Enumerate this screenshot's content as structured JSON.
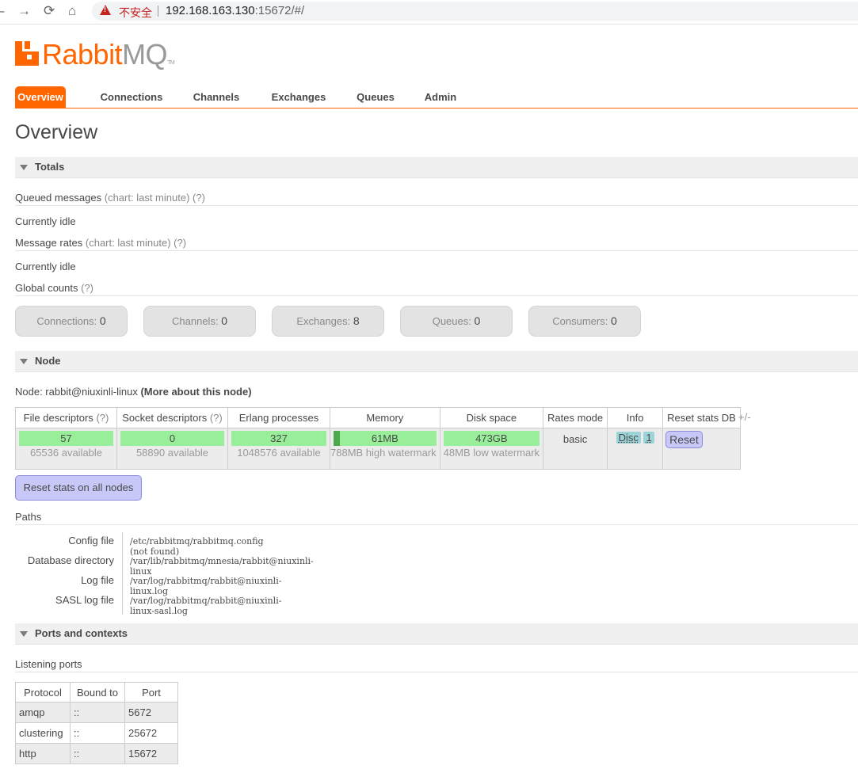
{
  "browser": {
    "back_icon": "back-arrow",
    "forward_icon": "forward-arrow",
    "reload_icon": "reload",
    "home_icon": "home",
    "security_text": "不安全",
    "url_host": "192.168.163.130",
    "url_rest": ":15672/#/"
  },
  "logo": {
    "rabbit": "Rabbit",
    "mq": "MQ",
    "tm": "TM"
  },
  "tabs": [
    "Overview",
    "Connections",
    "Channels",
    "Exchanges",
    "Queues",
    "Admin"
  ],
  "page_title": "Overview",
  "totals": {
    "title": "Totals",
    "queued_label": "Queued messages",
    "queued_hint": "(chart: last minute) (?)",
    "queued_state": "Currently idle",
    "rates_label": "Message rates",
    "rates_hint": "(chart: last minute) (?)",
    "rates_state": "Currently idle",
    "global_label": "Global counts",
    "global_hint": "(?)",
    "counts": [
      {
        "label": "Connections:",
        "value": "0"
      },
      {
        "label": "Channels:",
        "value": "0"
      },
      {
        "label": "Exchanges:",
        "value": "8"
      },
      {
        "label": "Queues:",
        "value": "0"
      },
      {
        "label": "Consumers:",
        "value": "0"
      }
    ]
  },
  "node": {
    "title": "Node",
    "node_label": "Node: rabbit@niuxinli-linux",
    "more_link": "(More about this node)",
    "headers": {
      "fd": "File descriptors",
      "fd_hint": "(?)",
      "sd": "Socket descriptors",
      "sd_hint": "(?)",
      "ep": "Erlang processes",
      "mem": "Memory",
      "disk": "Disk space",
      "rates": "Rates mode",
      "info": "Info",
      "reset": "Reset stats DB"
    },
    "plus_minus": "+/-",
    "values": {
      "fd": "57",
      "fd_sub": "65536 available",
      "sd": "0",
      "sd_sub": "58890 available",
      "ep": "327",
      "ep_sub": "1048576 available",
      "mem": "61MB",
      "mem_sub": "788MB high watermark",
      "disk": "473GB",
      "disk_sub": "48MB low watermark",
      "rates": "basic",
      "info_disc": "Disc",
      "info_num": "1",
      "reset_btn": "Reset"
    },
    "reset_all": "Reset stats on all nodes"
  },
  "paths": {
    "title": "Paths",
    "rows": [
      {
        "label": "Config file",
        "value": "/etc/rabbitmq/rabbitmq.config (not found)"
      },
      {
        "label": "Database directory",
        "value": "/var/lib/rabbitmq/mnesia/rabbit@niuxinli-linux"
      },
      {
        "label": "Log file",
        "value": "/var/log/rabbitmq/rabbit@niuxinli-linux.log"
      },
      {
        "label": "SASL log file",
        "value": "/var/log/rabbitmq/rabbit@niuxinli-linux-sasl.log"
      }
    ]
  },
  "ports": {
    "title": "Ports and contexts",
    "listening": "Listening ports",
    "headers": [
      "Protocol",
      "Bound to",
      "Port"
    ],
    "rows": [
      {
        "protocol": "amqp",
        "bound": "::",
        "port": "5672"
      },
      {
        "protocol": "clustering",
        "bound": "::",
        "port": "25672"
      },
      {
        "protocol": "http",
        "bound": "::",
        "port": "15672"
      }
    ]
  }
}
